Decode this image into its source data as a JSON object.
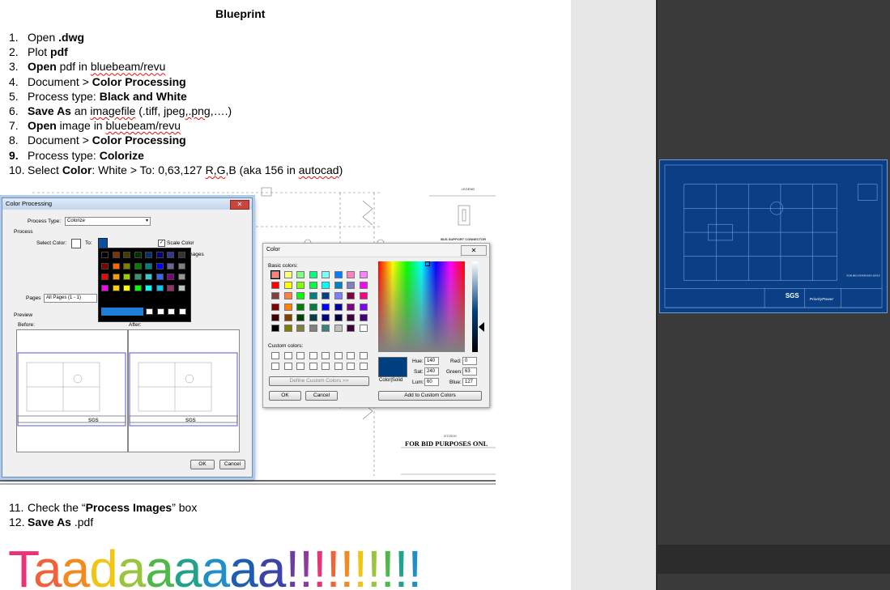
{
  "document": {
    "title": "Blueprint",
    "steps": [
      {
        "num": "1.",
        "parts": [
          {
            "t": "Open "
          },
          {
            "t": ".dwg",
            "b": true
          }
        ]
      },
      {
        "num": "2.",
        "parts": [
          {
            "t": "Plot "
          },
          {
            "t": "pdf",
            "b": true
          }
        ]
      },
      {
        "num": "3.",
        "parts": [
          {
            "t": "Open",
            "b": true
          },
          {
            "t": " pdf in "
          },
          {
            "t": "bluebeam/revu",
            "sq": true
          }
        ]
      },
      {
        "num": "4.",
        "parts": [
          {
            "t": "Document > "
          },
          {
            "t": "Color Processing",
            "b": true
          }
        ]
      },
      {
        "num": "5.",
        "parts": [
          {
            "t": "Process type: "
          },
          {
            "t": "Black and White",
            "b": true
          }
        ]
      },
      {
        "num": "6.",
        "parts": [
          {
            "t": "Save As",
            "b": true
          },
          {
            "t": " an "
          },
          {
            "t": "imagefile",
            "sq": true
          },
          {
            "t": " (.tiff, jpeg"
          },
          {
            "t": ",.",
            "sq": true
          },
          {
            "t": "png",
            "sq": true
          },
          {
            "t": ",….)"
          }
        ]
      },
      {
        "num": "7.",
        "parts": [
          {
            "t": "Open",
            "b": true
          },
          {
            "t": " image in "
          },
          {
            "t": "bluebeam/revu",
            "sq": true
          }
        ]
      },
      {
        "num": "8.",
        "parts": [
          {
            "t": "Document > "
          },
          {
            "t": "Color Processing",
            "b": true
          }
        ]
      },
      {
        "num": "9.",
        "nb": true,
        "parts": [
          {
            "t": "Process type: "
          },
          {
            "t": "Colorize",
            "b": true
          }
        ]
      },
      {
        "num": "10.",
        "parts": [
          {
            "t": "Select "
          },
          {
            "t": "Color",
            "b": true
          },
          {
            "t": ": White > To: 0,63,127 "
          },
          {
            "t": "R,G",
            "sq": true
          },
          {
            "t": ",B (aka 156 in "
          },
          {
            "t": "autocad",
            "sq": true
          },
          {
            "t": ")"
          }
        ]
      }
    ],
    "steps_after": [
      {
        "num": "11.",
        "parts": [
          {
            "t": "Check the “"
          },
          {
            "t": "Process Images",
            "b": true
          },
          {
            "t": "” box"
          }
        ]
      },
      {
        "num": "12.",
        "parts": [
          {
            "t": "Save As",
            "b": true
          },
          {
            "t": " .pdf"
          }
        ]
      }
    ],
    "tada": "Taadaaaaaa!!!!!!!!!!",
    "tada_colors": [
      "#e8327a",
      "#f0623a",
      "#f28a1e",
      "#f2c414",
      "#9ac43c",
      "#4fb84a",
      "#21a28a",
      "#1f8fc9",
      "#1d5fae",
      "#3a44a8",
      "#6a3da2",
      "#8c3a9e",
      "#e8327a",
      "#f0623a",
      "#f28a1e",
      "#f2c414",
      "#9ac43c",
      "#4fb84a",
      "#21a28a",
      "#1f8fc9"
    ]
  },
  "color_processing_dialog": {
    "title": "Color Processing",
    "process_type_label": "Process Type:",
    "process_type_value": "Colorize",
    "process_group": "Process",
    "select_color_label": "Select Color:",
    "to_label": "To:",
    "scale_color_label": "Scale Color",
    "process_images_partial": "nages",
    "pages_label": "Pages",
    "pages_value": "All Pages (1 - 1)",
    "preview_group": "Preview",
    "before_label": "Before:",
    "after_label": "After:",
    "custom_button": "Custom",
    "ok": "OK",
    "cancel": "Cancel"
  },
  "color_dialog": {
    "title": "Color",
    "basic_colors_label": "Basic colors:",
    "custom_colors_label": "Custom colors:",
    "define_custom": "Define Custom Colors >>",
    "ok": "OK",
    "cancel": "Cancel",
    "color_solid": "Color|Solid",
    "hue_label": "Hue:",
    "hue": "140",
    "sat_label": "Sat:",
    "sat": "240",
    "lum_label": "Lum:",
    "lum": "60",
    "red_label": "Red:",
    "red": "0",
    "green_label": "Green:",
    "green": "63",
    "blue_label": "Blue:",
    "blue": "127",
    "add_custom": "Add to Custom Colors",
    "selected_color": "#003f7f",
    "basic_colors": [
      "#ff8080",
      "#ffff80",
      "#80ff80",
      "#00ff80",
      "#80ffff",
      "#0080ff",
      "#ff80c0",
      "#ff80ff",
      "#ff0000",
      "#ffff00",
      "#80ff00",
      "#00ff40",
      "#00ffff",
      "#0080c0",
      "#8080c0",
      "#ff00ff",
      "#804040",
      "#ff8040",
      "#00ff00",
      "#008080",
      "#004080",
      "#8080ff",
      "#800040",
      "#ff0080",
      "#800000",
      "#ff8000",
      "#008000",
      "#008040",
      "#0000ff",
      "#0000a0",
      "#800080",
      "#8000ff",
      "#400000",
      "#804000",
      "#004000",
      "#004040",
      "#000080",
      "#000040",
      "#400040",
      "#400080",
      "#000000",
      "#808000",
      "#808040",
      "#808080",
      "#408080",
      "#c0c0c0",
      "#400040",
      "#ffffff"
    ]
  },
  "palette_popup": {
    "colors": [
      "#000000",
      "#7f3300",
      "#3f3f00",
      "#003300",
      "#003366",
      "#000080",
      "#333399",
      "#333333",
      "#800000",
      "#ff6600",
      "#808000",
      "#008000",
      "#008080",
      "#0000ff",
      "#666699",
      "#808080",
      "#ff0000",
      "#ff9900",
      "#99cc00",
      "#339966",
      "#33cccc",
      "#3366ff",
      "#800080",
      "#969696",
      "#ff00ff",
      "#ffcc00",
      "#ffff00",
      "#00ff00",
      "#00ffff",
      "#00ccff",
      "#993366",
      "#c0c0c0",
      "#ff99cc",
      "#ffcc99",
      "#ffff99",
      "#ccffcc",
      "#ccffff",
      "#99ccff",
      "#cc99ff",
      "#ffffff"
    ]
  },
  "drawing": {
    "legend": "LEGEND",
    "bid_purposes": "FOR BID PURPOSES ONL",
    "date": "2/7/2019",
    "bus_support": "BUS SUPPORT CONNECTOR"
  },
  "thumbnail": {
    "company": "SGS",
    "brand": "PriorityPower",
    "bid_note": "FOR BID PURPOSES ONLY"
  }
}
